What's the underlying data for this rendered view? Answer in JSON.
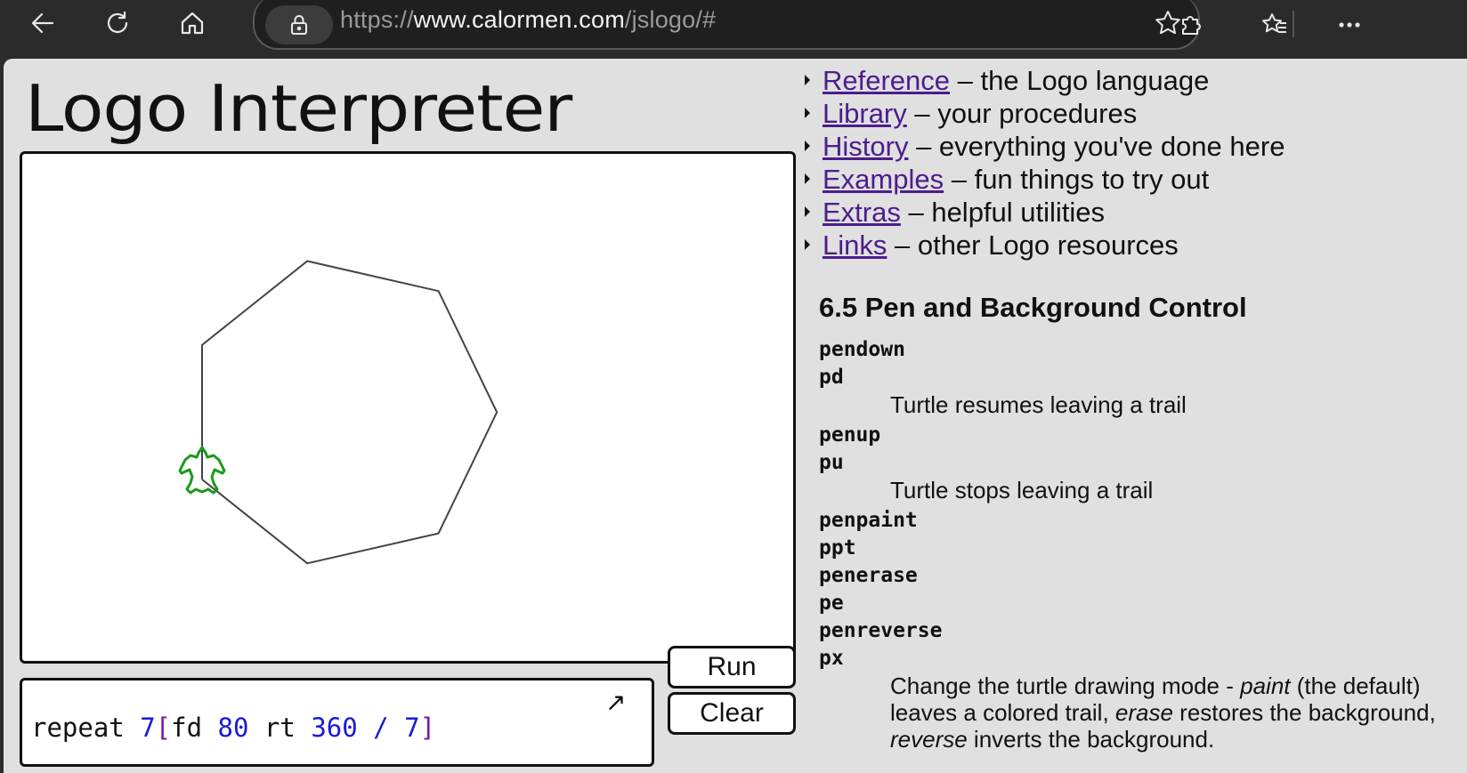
{
  "browser": {
    "url_scheme": "https://",
    "url_host": "www.calormen.com",
    "url_path": "/jslogo/#",
    "icons": [
      "back-icon",
      "refresh-icon",
      "home-icon",
      "lock-icon",
      "star-icon",
      "extensions-icon",
      "favorites-icon",
      "more-icon"
    ]
  },
  "page": {
    "title": "Logo Interpreter",
    "code": {
      "t1": "repeat ",
      "t2": "7",
      "t3": "[",
      "t4": "fd ",
      "t5": "80",
      "t6": " rt ",
      "t7": "360",
      "t8": " / ",
      "t9": "7",
      "t10": "]"
    },
    "expand_glyph": "↗",
    "run_label": "Run",
    "clear_label": "Clear",
    "canvas": {
      "polygon_sides": 7,
      "step": 80,
      "turn": "360 / 7",
      "line_color": "#444444",
      "turtle_color": "#1a9a1a"
    }
  },
  "sidebar": {
    "links": [
      {
        "label": "Reference",
        "desc": " – the Logo language"
      },
      {
        "label": "Library",
        "desc": " – your procedures"
      },
      {
        "label": "History",
        "desc": " – everything you've done here"
      },
      {
        "label": "Examples",
        "desc": " – fun things to try out"
      },
      {
        "label": "Extras",
        "desc": " – helpful utilities"
      },
      {
        "label": "Links",
        "desc": " – other Logo resources"
      }
    ],
    "section_title": "6.5 Pen and Background Control",
    "defs": {
      "pendown": "pendown",
      "pd": "pd",
      "pd_desc": "Turtle resumes leaving a trail",
      "penup": "penup",
      "pu": "pu",
      "pu_desc": "Turtle stops leaving a trail",
      "penpaint": "penpaint",
      "ppt": "ppt",
      "penerase": "penerase",
      "pe": "pe",
      "penreverse": "penreverse",
      "px": "px",
      "mode_desc_1": "Change the turtle drawing mode - ",
      "mode_paint": "paint",
      "mode_desc_2": " (the default) leaves a colored trail, ",
      "mode_erase": "erase",
      "mode_desc_3": " restores the background, ",
      "mode_reverse": "reverse",
      "mode_desc_4": " inverts the background."
    }
  }
}
